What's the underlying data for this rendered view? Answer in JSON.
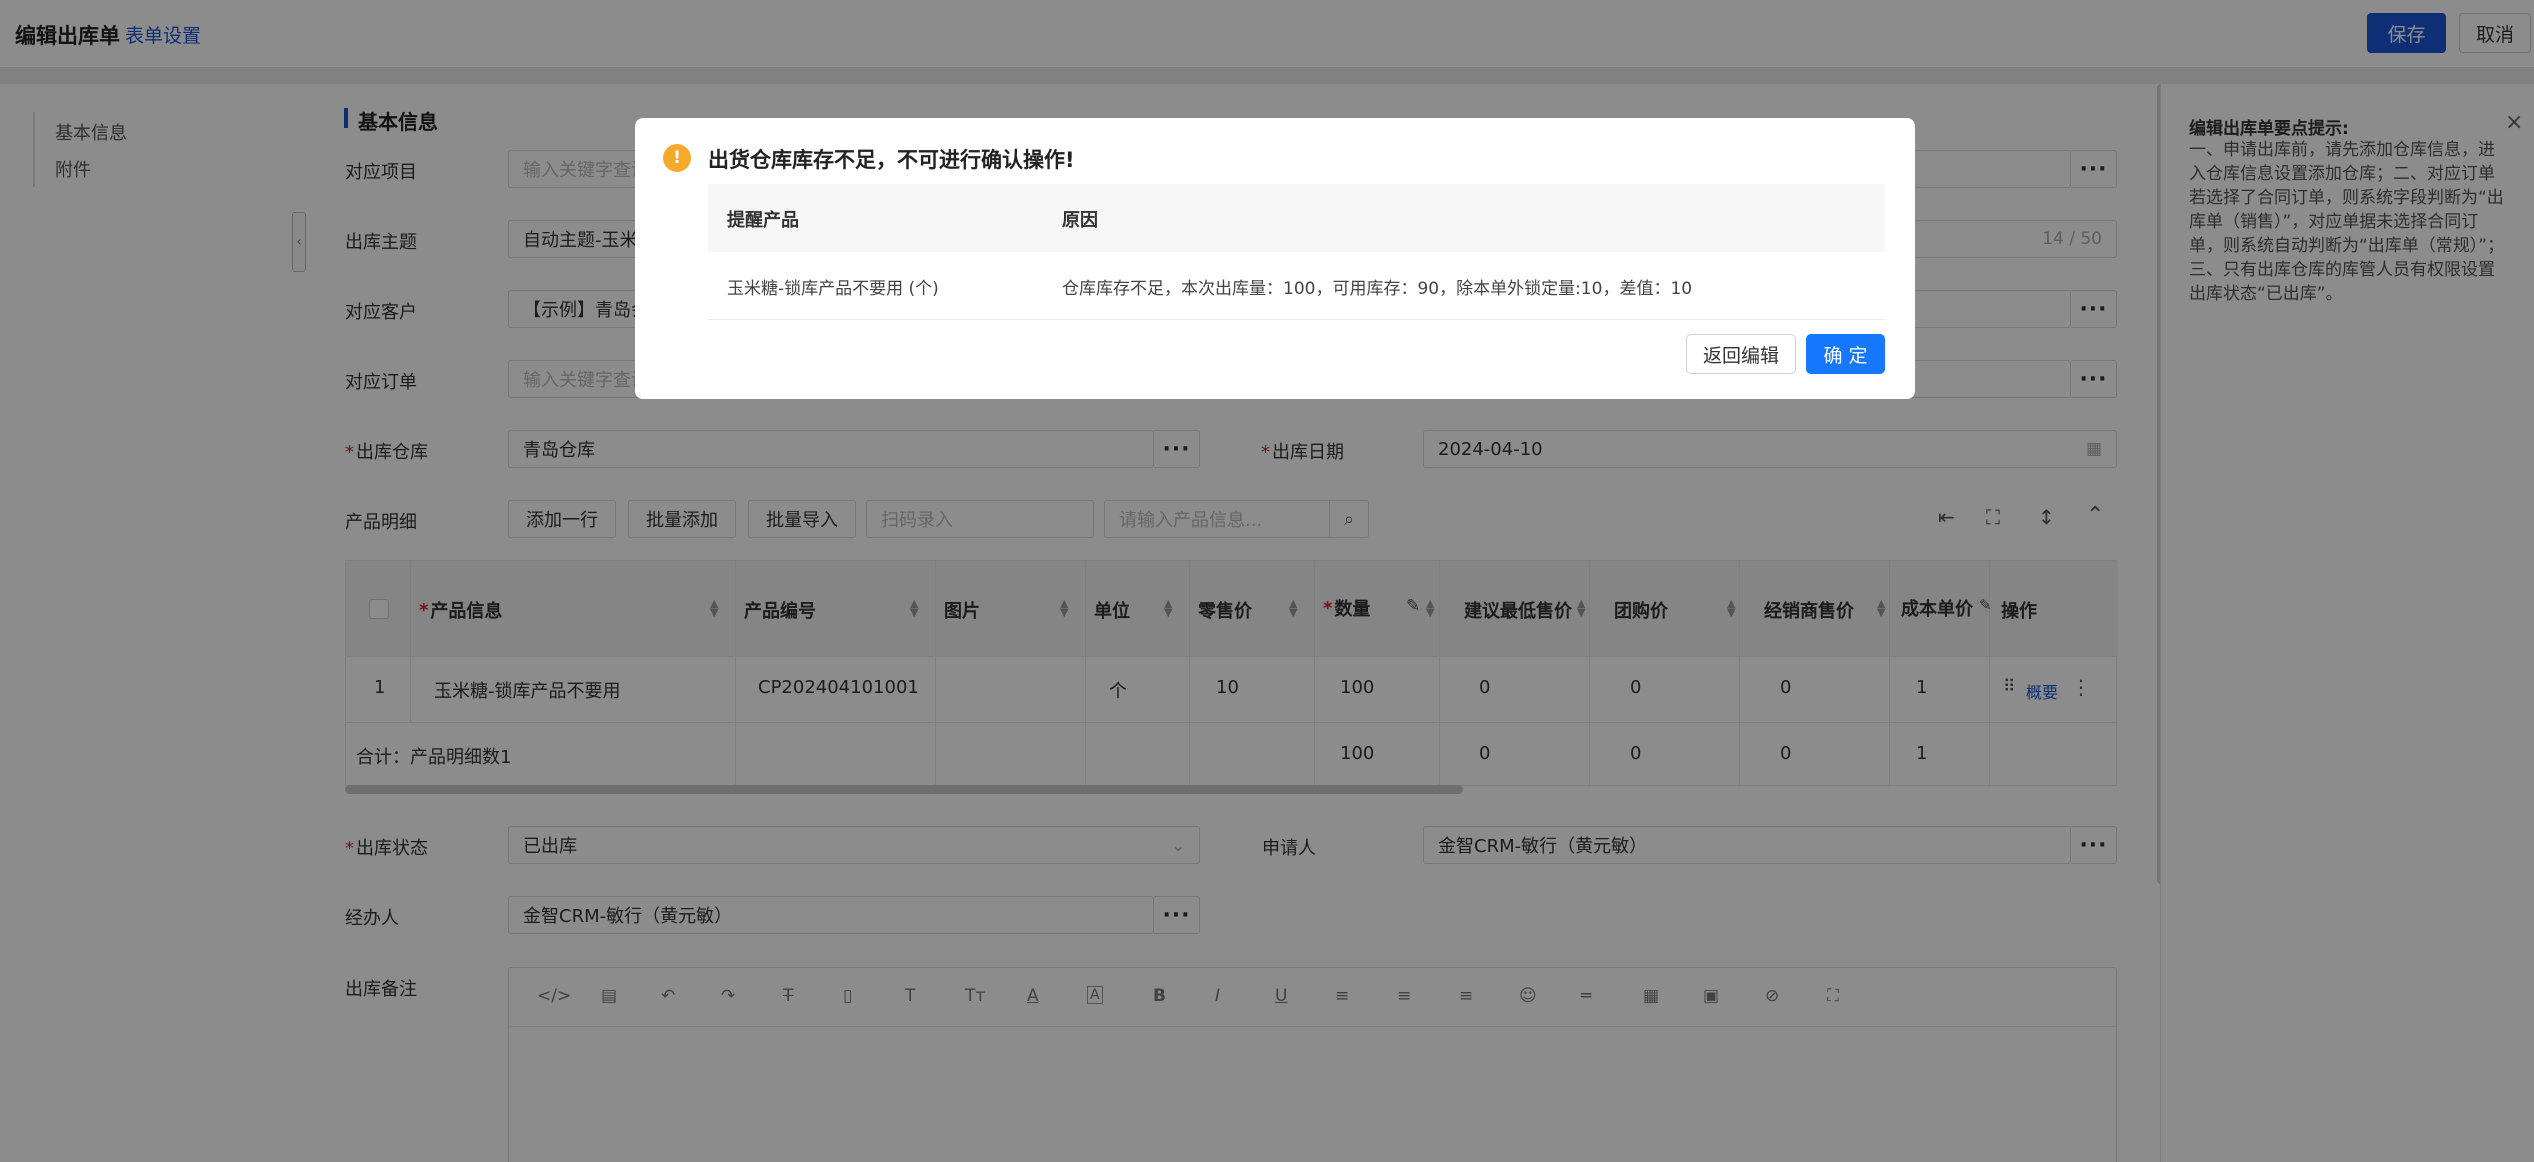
{
  "header": {
    "title": "编辑出库单",
    "form_settings": "表单设置",
    "save_label": "保存",
    "cancel_label": "取消"
  },
  "nav": {
    "items": [
      "基本信息",
      "附件"
    ]
  },
  "section": {
    "title": "基本信息"
  },
  "form": {
    "project": {
      "label": "对应项目",
      "placeholder": "输入关键字查询"
    },
    "subject": {
      "label": "出库主题",
      "value": "自动主题-玉米",
      "counter": "14 / 50"
    },
    "customer": {
      "label": "对应客户",
      "value": "【示例】青岛会"
    },
    "order": {
      "label": "对应订单",
      "placeholder": "输入关键字查询"
    },
    "warehouse": {
      "label": "出库仓库",
      "value": "青岛仓库"
    },
    "date": {
      "label": "出库日期",
      "value": "2024-04-10"
    },
    "product_detail": {
      "label": "产品明细",
      "add_row": "添加一行",
      "batch_add": "批量添加",
      "batch_import": "批量导入",
      "scan_placeholder": "扫码录入",
      "search_placeholder": "请输入产品信息..."
    },
    "status": {
      "label": "出库状态",
      "value": "已出库"
    },
    "applicant": {
      "label": "申请人",
      "value": "金智CRM-敏行（黄元敏）"
    },
    "handler": {
      "label": "经办人",
      "value": "金智CRM-敏行（黄元敏）"
    },
    "remark": {
      "label": "出库备注"
    }
  },
  "table": {
    "columns": [
      "产品信息",
      "产品编号",
      "图片",
      "单位",
      "零售价",
      "数量",
      "建议最低售价",
      "团购价",
      "经销商售价",
      "成本单价",
      "操作"
    ],
    "rows": [
      {
        "index": "1",
        "product": "玉米糖-锁库产品不要用",
        "code": "CP202404101001",
        "image": "",
        "unit": "个",
        "retail": "10",
        "qty": "100",
        "min_price": "0",
        "group_price": "0",
        "dealer_price": "0",
        "cost": "1",
        "action_link": "概要"
      }
    ],
    "summary": {
      "label": "合计：产品明细数1",
      "qty": "100",
      "min_price": "0",
      "group_price": "0",
      "dealer_price": "0",
      "cost": "1"
    }
  },
  "right_panel": {
    "title": "编辑出库单要点提示:",
    "text": "一、申请出库前，请先添加仓库信息，进入仓库信息设置添加仓库；二、对应订单若选择了合同订单，则系统字段判断为“出库单（销售）”，对应单据未选择合同订单，则系统自动判断为“出库单（常规）”；三、只有出库仓库的库管人员有权限设置出库状态“已出库”。"
  },
  "modal": {
    "title": "出货仓库库存不足，不可进行确认操作!",
    "col_product": "提醒产品",
    "col_reason": "原因",
    "row_product": "玉米糖-锁库产品不要用 (个)",
    "row_reason": "仓库库存不足，本次出库量：100，可用库存：90，除本单外锁定量:10，差值：10",
    "back_label": "返回编辑",
    "ok_label": "确 定"
  },
  "colors": {
    "primary": "#1a56d6",
    "confirm": "#1677ff",
    "warning": "#f7a92b",
    "required": "#e02020"
  }
}
